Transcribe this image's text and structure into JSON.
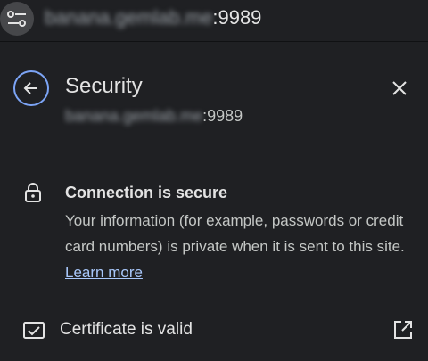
{
  "address_bar": {
    "site_info_icon": "tune-icon",
    "url_host_blurred": "banana.gemlab.me",
    "url_port": ":9989"
  },
  "popup": {
    "back_icon": "arrow-left-icon",
    "title": "Security",
    "subtitle_host_blurred": "banana.gemlab.me",
    "subtitle_port": ":9989",
    "close_icon": "close-icon",
    "connection": {
      "icon": "lock-icon",
      "title": "Connection is secure",
      "description": "Your information (for example, passwords or credit card numbers) is private when it is sent to this site.",
      "learn_more": "Learn more"
    },
    "certificate": {
      "icon": "certificate-icon",
      "label": "Certificate is valid",
      "open_icon": "open-in-new-icon"
    }
  },
  "colors": {
    "background": "#1f2023",
    "accent_ring": "#7ca4f5",
    "link": "#a8c7fa",
    "text_primary": "#e3e3e3",
    "text_secondary": "#c4c7c5"
  }
}
